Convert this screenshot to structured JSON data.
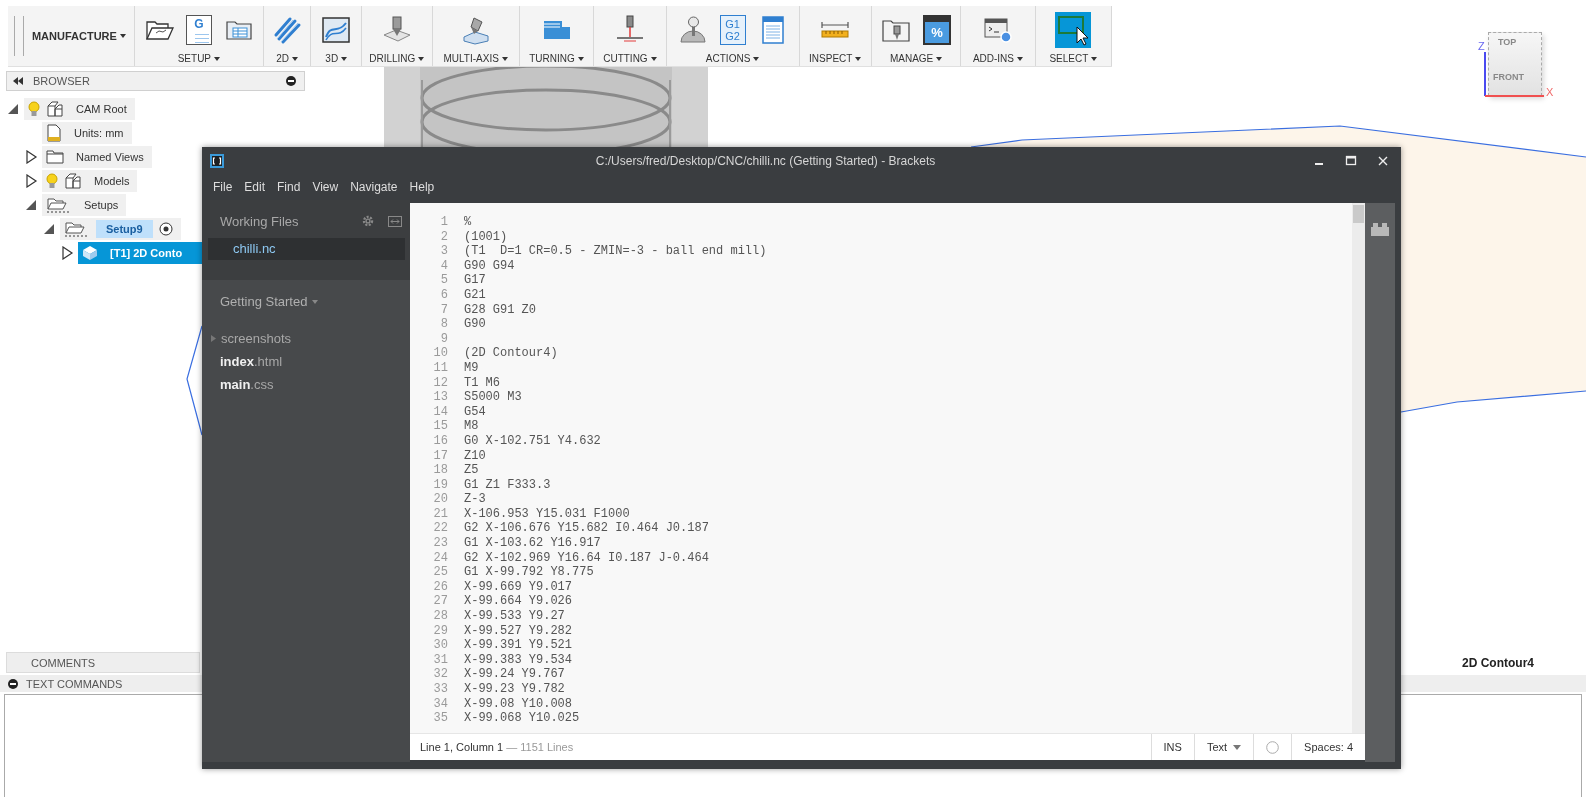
{
  "toolbar": {
    "workspace": "MANUFACTURE",
    "groups": [
      {
        "label": "SETUP",
        "tools": [
          {
            "kind": "setup"
          },
          {
            "kind": "program",
            "glyph_lines": [
              "G"
            ]
          },
          {
            "kind": "sheet"
          }
        ]
      },
      {
        "label": "2D",
        "tools": [
          {
            "kind": "contour"
          }
        ]
      },
      {
        "label": "3D",
        "tools": [
          {
            "kind": "surface"
          }
        ]
      },
      {
        "label": "DRILLING",
        "tools": [
          {
            "kind": "drill"
          }
        ]
      },
      {
        "label": "MULTI-AXIS",
        "tools": [
          {
            "kind": "multiaxis"
          }
        ]
      },
      {
        "label": "TURNING",
        "tools": [
          {
            "kind": "turning"
          }
        ]
      },
      {
        "label": "CUTTING",
        "tools": [
          {
            "kind": "cutting"
          }
        ]
      },
      {
        "label": "ACTIONS",
        "tools": [
          {
            "kind": "simulate"
          },
          {
            "kind": "post",
            "glyph_lines": [
              "G1",
              "G2"
            ]
          },
          {
            "kind": "document"
          }
        ]
      },
      {
        "label": "INSPECT",
        "tools": [
          {
            "kind": "measure"
          }
        ]
      },
      {
        "label": "MANAGE",
        "tools": [
          {
            "kind": "library"
          },
          {
            "kind": "template",
            "glyph_lines": [
              "%"
            ]
          }
        ]
      },
      {
        "label": "ADD-INS",
        "tools": [
          {
            "kind": "scripts"
          }
        ]
      },
      {
        "label": "SELECT",
        "tools": [
          {
            "kind": "select"
          }
        ]
      }
    ]
  },
  "browser": {
    "title": "BROWSER",
    "tree": [
      {
        "label": "CAM Root",
        "kind": "root",
        "expanded": true,
        "selected": false,
        "active": false,
        "children": [
          {
            "label": "Units: mm",
            "kind": "units",
            "selected": false,
            "active": false
          },
          {
            "label": "Named Views",
            "kind": "views",
            "expanded": false,
            "selected": false,
            "active": false
          },
          {
            "label": "Models",
            "kind": "models",
            "expanded": false,
            "selected": false,
            "active": false
          },
          {
            "label": "Setups",
            "kind": "setups",
            "expanded": true,
            "selected": false,
            "active": false,
            "children": [
              {
                "label": "Setup9",
                "kind": "setup",
                "expanded": true,
                "selected": false,
                "active": true,
                "children": [
                  {
                    "label": "[T1] 2D Conto",
                    "kind": "operation",
                    "expanded": false,
                    "selected": true,
                    "active": false
                  }
                ]
              }
            ]
          }
        ]
      }
    ]
  },
  "viewcube": {
    "top": "TOP",
    "front": "FRONT",
    "z_axis": "Z",
    "x_axis": "X"
  },
  "canvas_label": "2D Contour4",
  "comments": {
    "title": "COMMENTS"
  },
  "text_commands": {
    "title": "TEXT COMMANDS"
  },
  "brackets": {
    "title": "C:/Users/fred/Desktop/CNC/chilli.nc (Getting Started) - Brackets",
    "menu": [
      "File",
      "Edit",
      "Find",
      "View",
      "Navigate",
      "Help"
    ],
    "working_files_title": "Working Files",
    "working_files": [
      {
        "name": "chilli.nc",
        "selected": true
      }
    ],
    "project": "Getting Started",
    "files": [
      {
        "kind": "folder",
        "name": "screenshots"
      },
      {
        "kind": "file",
        "name": "**index**.html"
      },
      {
        "kind": "file",
        "name": "**main**.css"
      }
    ],
    "lines": [
      {
        "number": "1",
        "code": "%"
      },
      {
        "number": "2",
        "code": "(1001)"
      },
      {
        "number": "3",
        "code": "(T1  D=1 CR=0.5 - ZMIN=-3 - ball end mill)"
      },
      {
        "number": "4",
        "code": "G90 G94"
      },
      {
        "number": "5",
        "code": "G17"
      },
      {
        "number": "6",
        "code": "G21"
      },
      {
        "number": "7",
        "code": "G28 G91 Z0"
      },
      {
        "number": "8",
        "code": "G90"
      },
      {
        "number": "9"
      },
      {
        "number": "10",
        "code": "(2D Contour4)"
      },
      {
        "number": "11",
        "code": "M9"
      },
      {
        "number": "12",
        "code": "T1 M6"
      },
      {
        "number": "13",
        "code": "S5000 M3"
      },
      {
        "number": "14",
        "code": "G54"
      },
      {
        "number": "15",
        "code": "M8"
      },
      {
        "number": "16",
        "code": "G0 X-102.751 Y4.632"
      },
      {
        "number": "17",
        "code": "Z10"
      },
      {
        "number": "18",
        "code": "Z5"
      },
      {
        "number": "19",
        "code": "G1 Z1 F333.3"
      },
      {
        "number": "20",
        "code": "Z-3"
      },
      {
        "number": "21",
        "code": "X-106.953 Y15.031 F1000"
      },
      {
        "number": "22",
        "code": "G2 X-106.676 Y15.682 I0.464 J0.187"
      },
      {
        "number": "23",
        "code": "G1 X-103.62 Y16.917"
      },
      {
        "number": "24",
        "code": "G2 X-102.969 Y16.64 I0.187 J-0.464"
      },
      {
        "number": "25",
        "code": "G1 X-99.792 Y8.775"
      },
      {
        "number": "26",
        "code": "X-99.669 Y9.017"
      },
      {
        "number": "27",
        "code": "X-99.664 Y9.026"
      },
      {
        "number": "28",
        "code": "X-99.533 Y9.27"
      },
      {
        "number": "29",
        "code": "X-99.527 Y9.282"
      },
      {
        "number": "30",
        "code": "X-99.391 Y9.521"
      },
      {
        "number": "31",
        "code": "X-99.383 Y9.534"
      },
      {
        "number": "32",
        "code": "X-99.24 Y9.767"
      },
      {
        "number": "33",
        "code": "X-99.23 Y9.782"
      },
      {
        "number": "34",
        "code": "X-99.08 Y10.008"
      },
      {
        "number": "35",
        "code": "X-99.068 Y10.025"
      }
    ],
    "status": {
      "position": "Line 1, Column 1",
      "line_count": "— 1151 Lines",
      "mode": "INS",
      "language": "Text",
      "indent": "Spaces: 4"
    }
  }
}
